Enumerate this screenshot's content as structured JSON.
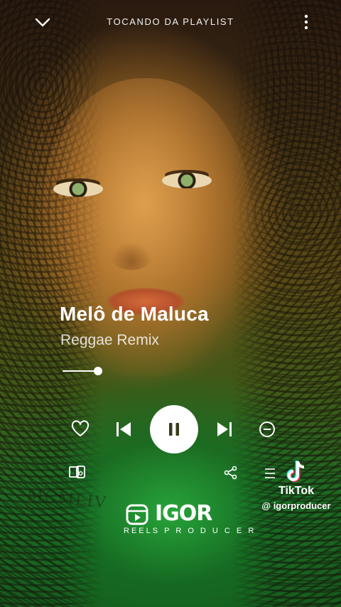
{
  "header": {
    "title": "TOCANDO DA PLAYLIST",
    "back_icon": "chevron-down-icon",
    "menu_icon": "more-vertical-icon"
  },
  "track": {
    "title": "Melô de Maluca",
    "subtitle": "Reggae Remix",
    "progress": 0.06
  },
  "controls": {
    "like_icon": "heart-icon",
    "previous_icon": "skip-previous-icon",
    "play_state_icon": "pause-icon",
    "next_icon": "skip-next-icon",
    "remove_icon": "minus-circle-icon",
    "device_icon": "connect-device-icon",
    "share_icon": "share-icon",
    "queue_icon": "queue-icon"
  },
  "overlay": {
    "tiktok_name": "TikTok",
    "tiktok_handle": "@ igorproducer",
    "watermark_main": "IGOR",
    "watermark_sub": "REELS P R O D U C E R",
    "shirt_text": "MCMLIV"
  },
  "colors": {
    "accent": "#ffffff",
    "background_top": "#2a1a10",
    "background_bottom": "#165a1c"
  }
}
